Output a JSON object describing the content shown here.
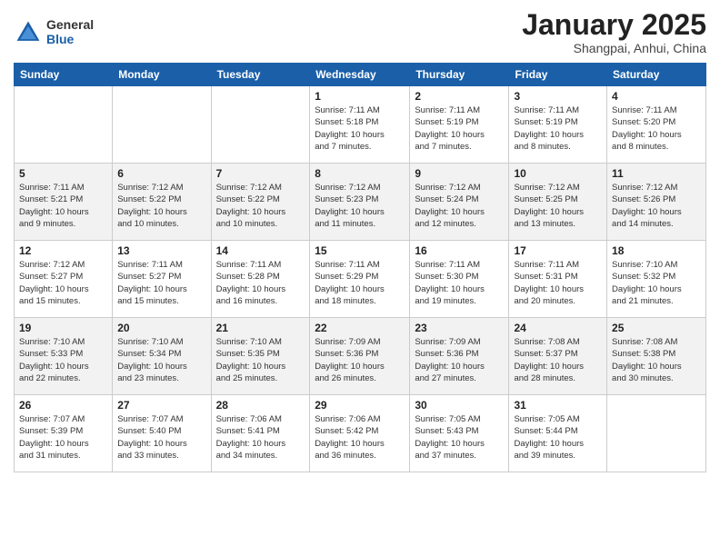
{
  "header": {
    "logo_general": "General",
    "logo_blue": "Blue",
    "month": "January 2025",
    "location": "Shangpai, Anhui, China"
  },
  "days_of_week": [
    "Sunday",
    "Monday",
    "Tuesday",
    "Wednesday",
    "Thursday",
    "Friday",
    "Saturday"
  ],
  "weeks": [
    [
      {
        "day": "",
        "info": ""
      },
      {
        "day": "",
        "info": ""
      },
      {
        "day": "",
        "info": ""
      },
      {
        "day": "1",
        "info": "Sunrise: 7:11 AM\nSunset: 5:18 PM\nDaylight: 10 hours\nand 7 minutes."
      },
      {
        "day": "2",
        "info": "Sunrise: 7:11 AM\nSunset: 5:19 PM\nDaylight: 10 hours\nand 7 minutes."
      },
      {
        "day": "3",
        "info": "Sunrise: 7:11 AM\nSunset: 5:19 PM\nDaylight: 10 hours\nand 8 minutes."
      },
      {
        "day": "4",
        "info": "Sunrise: 7:11 AM\nSunset: 5:20 PM\nDaylight: 10 hours\nand 8 minutes."
      }
    ],
    [
      {
        "day": "5",
        "info": "Sunrise: 7:11 AM\nSunset: 5:21 PM\nDaylight: 10 hours\nand 9 minutes."
      },
      {
        "day": "6",
        "info": "Sunrise: 7:12 AM\nSunset: 5:22 PM\nDaylight: 10 hours\nand 10 minutes."
      },
      {
        "day": "7",
        "info": "Sunrise: 7:12 AM\nSunset: 5:22 PM\nDaylight: 10 hours\nand 10 minutes."
      },
      {
        "day": "8",
        "info": "Sunrise: 7:12 AM\nSunset: 5:23 PM\nDaylight: 10 hours\nand 11 minutes."
      },
      {
        "day": "9",
        "info": "Sunrise: 7:12 AM\nSunset: 5:24 PM\nDaylight: 10 hours\nand 12 minutes."
      },
      {
        "day": "10",
        "info": "Sunrise: 7:12 AM\nSunset: 5:25 PM\nDaylight: 10 hours\nand 13 minutes."
      },
      {
        "day": "11",
        "info": "Sunrise: 7:12 AM\nSunset: 5:26 PM\nDaylight: 10 hours\nand 14 minutes."
      }
    ],
    [
      {
        "day": "12",
        "info": "Sunrise: 7:12 AM\nSunset: 5:27 PM\nDaylight: 10 hours\nand 15 minutes."
      },
      {
        "day": "13",
        "info": "Sunrise: 7:11 AM\nSunset: 5:27 PM\nDaylight: 10 hours\nand 15 minutes."
      },
      {
        "day": "14",
        "info": "Sunrise: 7:11 AM\nSunset: 5:28 PM\nDaylight: 10 hours\nand 16 minutes."
      },
      {
        "day": "15",
        "info": "Sunrise: 7:11 AM\nSunset: 5:29 PM\nDaylight: 10 hours\nand 18 minutes."
      },
      {
        "day": "16",
        "info": "Sunrise: 7:11 AM\nSunset: 5:30 PM\nDaylight: 10 hours\nand 19 minutes."
      },
      {
        "day": "17",
        "info": "Sunrise: 7:11 AM\nSunset: 5:31 PM\nDaylight: 10 hours\nand 20 minutes."
      },
      {
        "day": "18",
        "info": "Sunrise: 7:10 AM\nSunset: 5:32 PM\nDaylight: 10 hours\nand 21 minutes."
      }
    ],
    [
      {
        "day": "19",
        "info": "Sunrise: 7:10 AM\nSunset: 5:33 PM\nDaylight: 10 hours\nand 22 minutes."
      },
      {
        "day": "20",
        "info": "Sunrise: 7:10 AM\nSunset: 5:34 PM\nDaylight: 10 hours\nand 23 minutes."
      },
      {
        "day": "21",
        "info": "Sunrise: 7:10 AM\nSunset: 5:35 PM\nDaylight: 10 hours\nand 25 minutes."
      },
      {
        "day": "22",
        "info": "Sunrise: 7:09 AM\nSunset: 5:36 PM\nDaylight: 10 hours\nand 26 minutes."
      },
      {
        "day": "23",
        "info": "Sunrise: 7:09 AM\nSunset: 5:36 PM\nDaylight: 10 hours\nand 27 minutes."
      },
      {
        "day": "24",
        "info": "Sunrise: 7:08 AM\nSunset: 5:37 PM\nDaylight: 10 hours\nand 28 minutes."
      },
      {
        "day": "25",
        "info": "Sunrise: 7:08 AM\nSunset: 5:38 PM\nDaylight: 10 hours\nand 30 minutes."
      }
    ],
    [
      {
        "day": "26",
        "info": "Sunrise: 7:07 AM\nSunset: 5:39 PM\nDaylight: 10 hours\nand 31 minutes."
      },
      {
        "day": "27",
        "info": "Sunrise: 7:07 AM\nSunset: 5:40 PM\nDaylight: 10 hours\nand 33 minutes."
      },
      {
        "day": "28",
        "info": "Sunrise: 7:06 AM\nSunset: 5:41 PM\nDaylight: 10 hours\nand 34 minutes."
      },
      {
        "day": "29",
        "info": "Sunrise: 7:06 AM\nSunset: 5:42 PM\nDaylight: 10 hours\nand 36 minutes."
      },
      {
        "day": "30",
        "info": "Sunrise: 7:05 AM\nSunset: 5:43 PM\nDaylight: 10 hours\nand 37 minutes."
      },
      {
        "day": "31",
        "info": "Sunrise: 7:05 AM\nSunset: 5:44 PM\nDaylight: 10 hours\nand 39 minutes."
      },
      {
        "day": "",
        "info": ""
      }
    ]
  ]
}
